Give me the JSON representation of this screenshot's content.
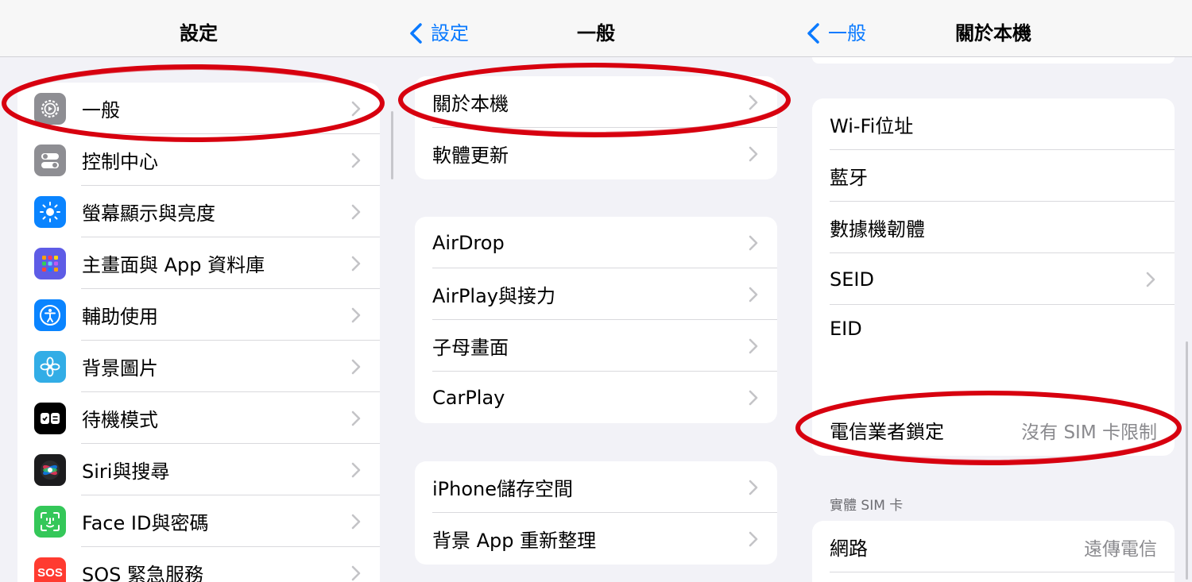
{
  "panel1": {
    "title": "設定",
    "items": [
      {
        "label": "一般",
        "icon": "gear-icon",
        "color": "#8e8e93"
      },
      {
        "label": "控制中心",
        "icon": "toggles-icon",
        "color": "#8e8e93"
      },
      {
        "label": "螢幕顯示與亮度",
        "icon": "brightness-icon",
        "color": "#0a84ff"
      },
      {
        "label": "主畫面與 App 資料庫",
        "icon": "app-grid-icon",
        "color": "#5e5ce6"
      },
      {
        "label": "輔助使用",
        "icon": "accessibility-icon",
        "color": "#0a84ff"
      },
      {
        "label": "背景圖片",
        "icon": "flower-icon",
        "color": "#32ade6"
      },
      {
        "label": "待機模式",
        "icon": "standby-icon",
        "color": "#000000"
      },
      {
        "label": "Siri與搜尋",
        "icon": "siri-icon",
        "color": "#1c1c1e"
      },
      {
        "label": "Face ID與密碼",
        "icon": "face-id-icon",
        "color": "#34c759"
      },
      {
        "label": "SOS 緊急服務",
        "icon": "sos-icon",
        "color": "#ff3b30",
        "icon_text": "SOS"
      }
    ]
  },
  "panel2": {
    "back": "設定",
    "title": "一般",
    "groups": [
      [
        "關於本機",
        "軟體更新"
      ],
      [
        "AirDrop",
        "AirPlay與接力",
        "子母畫面",
        "CarPlay"
      ],
      [
        "iPhone儲存空間",
        "背景 App 重新整理"
      ]
    ]
  },
  "panel3": {
    "back": "一般",
    "title": "關於本機",
    "info_rows": [
      {
        "label": "Wi-Fi位址",
        "value": "",
        "chevron": false
      },
      {
        "label": "藍牙",
        "value": "",
        "chevron": false
      },
      {
        "label": "數據機韌體",
        "value": "",
        "chevron": false
      },
      {
        "label": "SEID",
        "value": "",
        "chevron": true
      },
      {
        "label": "EID",
        "value": "",
        "chevron": false
      }
    ],
    "carrier_lock": {
      "label": "電信業者鎖定",
      "value": "沒有 SIM 卡限制"
    },
    "sim_section_header": "實體 SIM 卡",
    "network": {
      "label": "網路",
      "value": "遠傳電信"
    }
  },
  "colors": {
    "accent": "#0a7aff",
    "highlight": "#d7000f"
  }
}
